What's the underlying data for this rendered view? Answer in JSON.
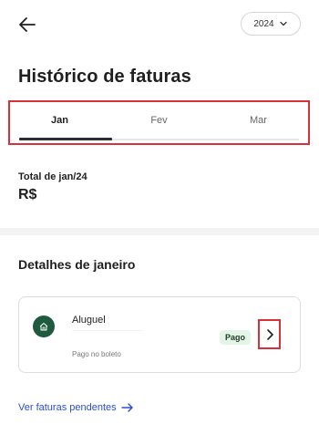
{
  "header": {
    "back_icon": "arrow-left-icon",
    "year_selector": {
      "value": "2024",
      "icon": "chevron-down-icon"
    }
  },
  "page": {
    "title": "Histórico de faturas"
  },
  "tabs": [
    {
      "label": "Jan",
      "active": true
    },
    {
      "label": "Fev",
      "active": false
    },
    {
      "label": "Mar",
      "active": false
    }
  ],
  "summary": {
    "total_label": "Total de jan/24",
    "total_value": "R$"
  },
  "details": {
    "title": "Detalhes de janeiro",
    "bills": [
      {
        "name": "Aluguel",
        "payment_method": "Pago no boleto",
        "status": "Pago",
        "icon": "home-icon",
        "action_icon": "chevron-right-icon"
      }
    ]
  },
  "footer": {
    "pending_link_label": "Ver faturas pendentes",
    "pending_link_icon": "arrow-right-icon"
  },
  "colors": {
    "accent_green": "#1e5a3d",
    "badge_green": "#e3f5e6",
    "link_blue": "#2c4dd3",
    "highlight_red": "#d9303a"
  }
}
